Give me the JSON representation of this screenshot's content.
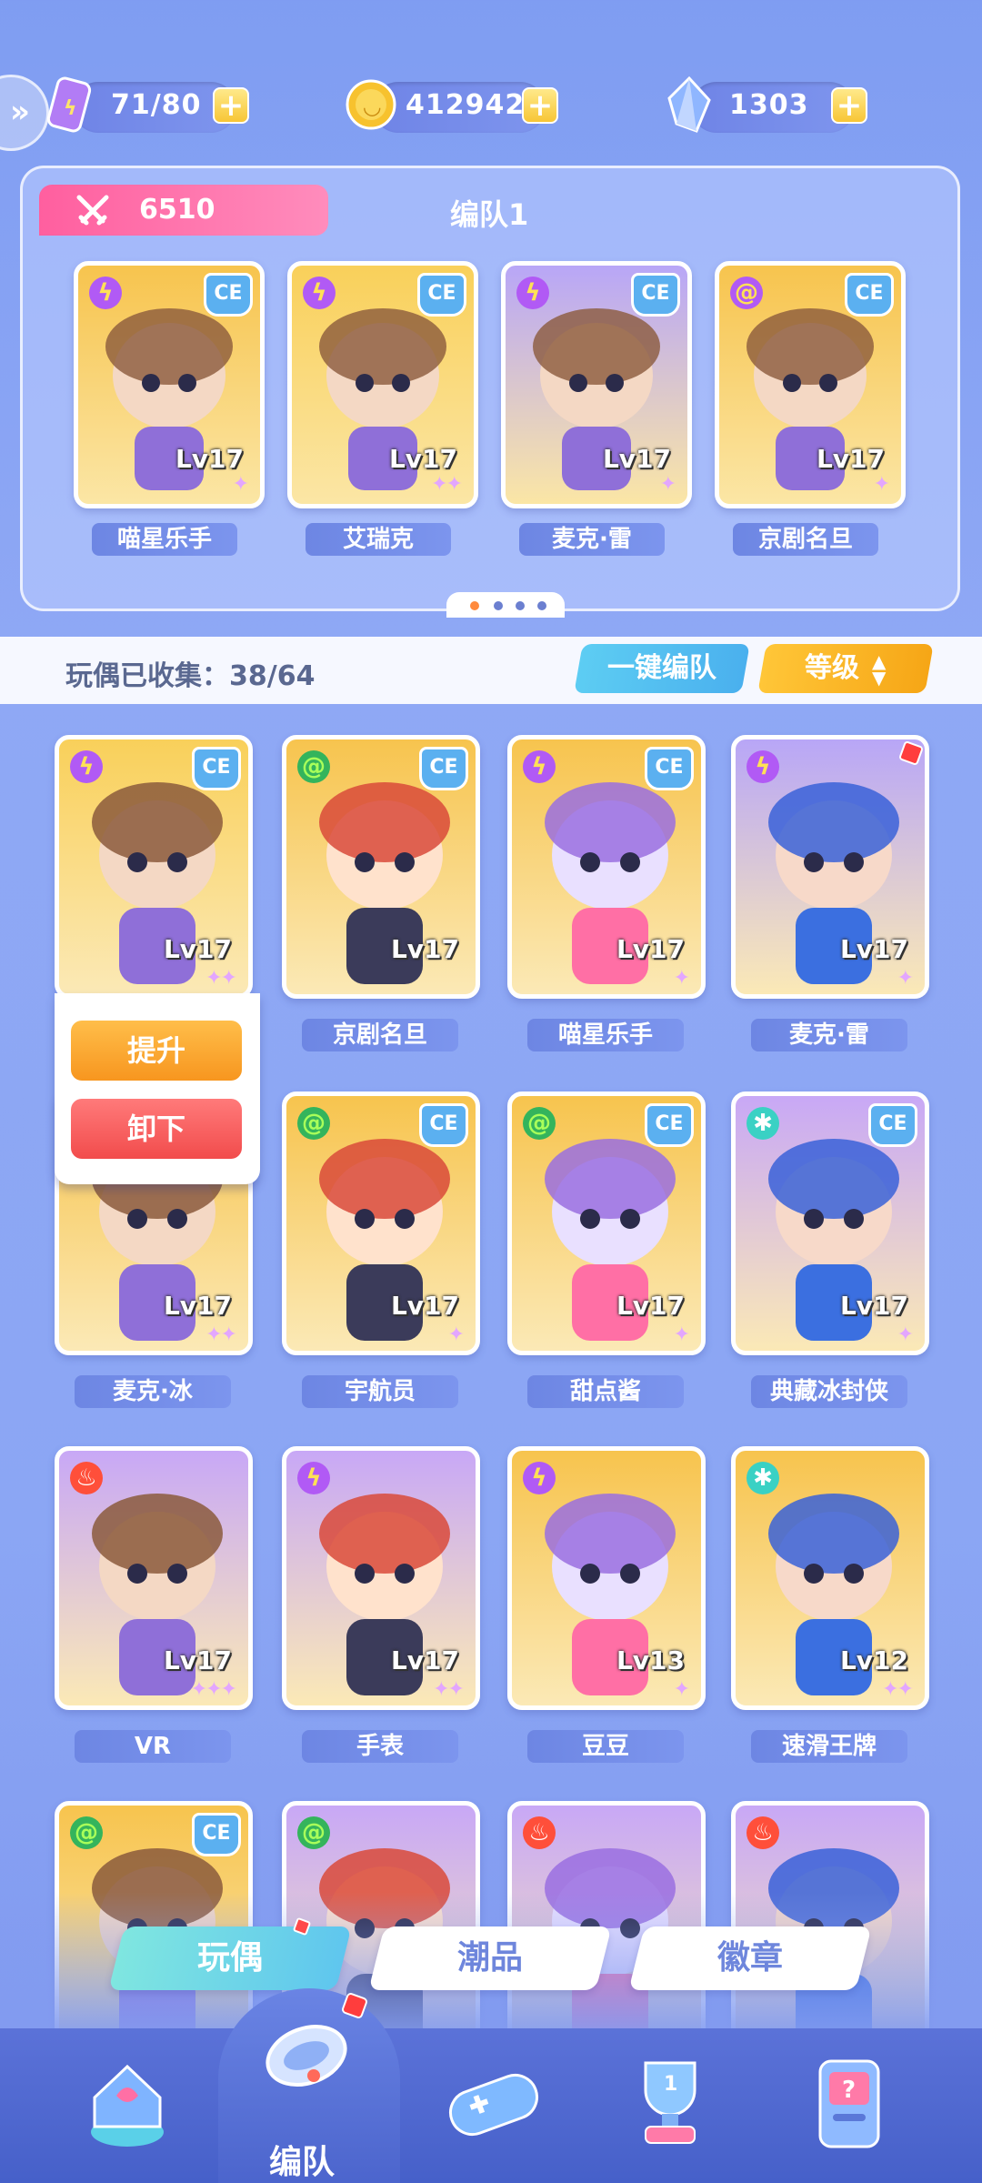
{
  "resources": {
    "stamina": {
      "value": "71/80",
      "icon": "energy-bottle-icon"
    },
    "coins": {
      "value": "412942",
      "icon": "gold-coin-icon"
    },
    "gems": {
      "value": "1303",
      "icon": "crystal-icon"
    }
  },
  "team": {
    "power": "6510",
    "title": "编队1",
    "members": [
      {
        "name": "喵星乐手",
        "level": "Lv17",
        "element": "lightning",
        "stars": 1,
        "color": "#f7c44e"
      },
      {
        "name": "艾瑞克",
        "level": "Lv17",
        "element": "lightning",
        "stars": 2,
        "color": "#f9d05a"
      },
      {
        "name": "麦克·雷",
        "level": "Lv17",
        "element": "lightning",
        "stars": 1,
        "color": "#b8a6f7"
      },
      {
        "name": "京剧名旦",
        "level": "Lv17",
        "element": "wind",
        "stars": 1,
        "color": "#f7c44e"
      }
    ]
  },
  "collection": {
    "label": "玩偶已收集：38/64",
    "one_key_button": "一键编队",
    "sort_button": "等级"
  },
  "popup": {
    "upgrade": "提升",
    "unload": "卸下"
  },
  "grid": [
    {
      "name": "",
      "level": "Lv17",
      "element": "lightning",
      "el_glyph": "ϟ",
      "ce": true,
      "stars": 2,
      "color": "#f9d05a"
    },
    {
      "name": "京剧名旦",
      "level": "Lv17",
      "element": "wind",
      "el_glyph": "@",
      "ce": true,
      "stars": 0,
      "color": "#f7c44e"
    },
    {
      "name": "喵星乐手",
      "level": "Lv17",
      "element": "lightning",
      "el_glyph": "ϟ",
      "ce": true,
      "stars": 1,
      "color": "#f7c44e"
    },
    {
      "name": "麦克·雷",
      "level": "Lv17",
      "element": "lightning",
      "el_glyph": "ϟ",
      "ce": false,
      "stars": 1,
      "color": "#b8a6f7",
      "badge": true
    },
    {
      "name": "麦克·冰",
      "level": "Lv17",
      "element": "",
      "el_glyph": "",
      "ce": false,
      "stars": 2,
      "color": "#f7c44e"
    },
    {
      "name": "宇航员",
      "level": "Lv17",
      "element": "wind",
      "el_glyph": "@",
      "ce": true,
      "stars": 1,
      "color": "#f7c44e"
    },
    {
      "name": "甜点酱",
      "level": "Lv17",
      "element": "wind",
      "el_glyph": "@",
      "ce": true,
      "stars": 1,
      "color": "#f7c44e"
    },
    {
      "name": "典藏冰封侠",
      "level": "Lv17",
      "element": "ice",
      "el_glyph": "✱",
      "ce": true,
      "stars": 1,
      "color": "#c8a8f6"
    },
    {
      "name": "VR",
      "level": "Lv17",
      "element": "fire",
      "el_glyph": "♨",
      "ce": false,
      "stars": 3,
      "color": "#c8a8f6"
    },
    {
      "name": "手表",
      "level": "Lv17",
      "element": "lightning",
      "el_glyph": "ϟ",
      "ce": false,
      "stars": 2,
      "color": "#c8a8f6"
    },
    {
      "name": "豆豆",
      "level": "Lv13",
      "element": "lightning",
      "el_glyph": "ϟ",
      "ce": false,
      "stars": 1,
      "color": "#f7c44e"
    },
    {
      "name": "速滑王牌",
      "level": "Lv12",
      "element": "ice",
      "el_glyph": "✱",
      "ce": false,
      "stars": 2,
      "color": "#f7c44e"
    },
    {
      "name": "",
      "level": "",
      "element": "wind",
      "el_glyph": "@",
      "ce": true,
      "stars": 0,
      "color": "#f7c44e"
    },
    {
      "name": "",
      "level": "",
      "element": "wind",
      "el_glyph": "@",
      "ce": false,
      "stars": 0,
      "color": "#c8a8f6"
    },
    {
      "name": "",
      "level": "",
      "element": "fire",
      "el_glyph": "♨",
      "ce": false,
      "stars": 0,
      "color": "#c8a8f6"
    },
    {
      "name": "",
      "level": "",
      "element": "fire",
      "el_glyph": "♨",
      "ce": false,
      "stars": 0,
      "color": "#c8a8f6"
    }
  ],
  "tabs": [
    {
      "label": "玩偶",
      "active": true
    },
    {
      "label": "潮品",
      "active": false
    },
    {
      "label": "徽章",
      "active": false
    }
  ],
  "nav": {
    "items": [
      "home-icon",
      "team-icon",
      "gamepad-icon",
      "trophy-icon",
      "mystery-machine-icon"
    ],
    "active_label": "编队"
  }
}
